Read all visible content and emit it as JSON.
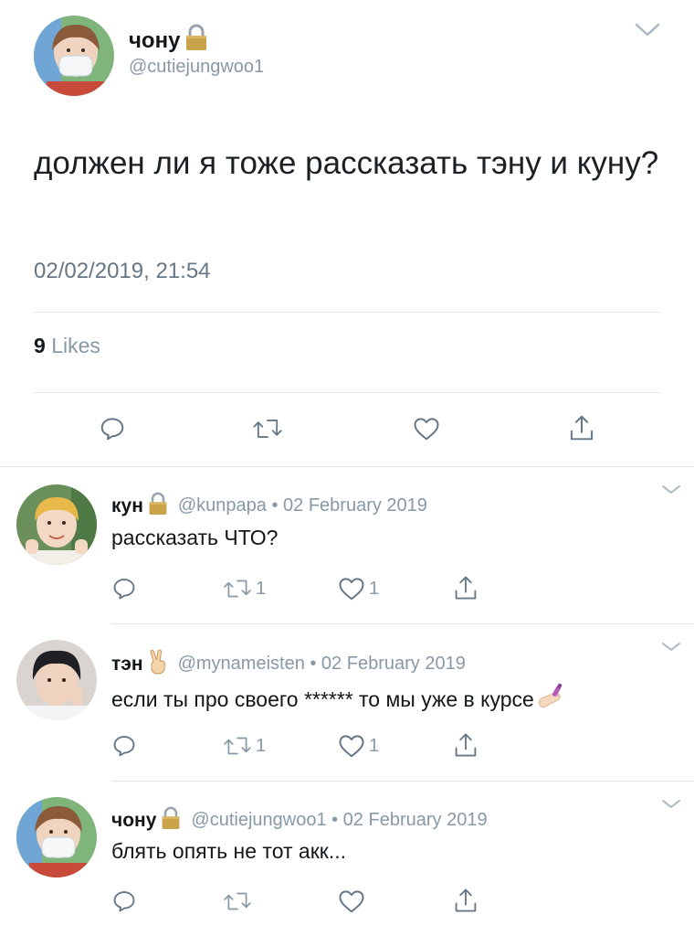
{
  "main_tweet": {
    "name": "чону",
    "handle": "@cutiejungwoo1",
    "text": "должен ли я тоже рассказать тэну и куну?",
    "timestamp": "02/02/2019, 21:54",
    "likes_count": "9",
    "likes_label": "Likes"
  },
  "replies": [
    {
      "name": "кун",
      "meta": "@kunpapa • 02 February 2019",
      "text": "рассказать ЧТО?",
      "retweets": "1",
      "likes": "1"
    },
    {
      "name": "тэн",
      "meta": "@mynameisten • 02 February 2019",
      "text": "если ты про своего ****** то мы уже в курсе",
      "retweets": "1",
      "likes": "1"
    },
    {
      "name": "чону",
      "meta": "@cutiejungwoo1 • 02 February 2019",
      "text": "блять опять не тот акк...",
      "retweets": "",
      "likes": ""
    }
  ],
  "colors": {
    "secondary_text": "#8899a6",
    "divider": "#e1e8ed",
    "lock_body": "#c9a24a"
  },
  "icons": [
    "chevron-down-icon",
    "lock-icon",
    "victory-hand-icon",
    "nail-polish-icon",
    "reply-icon",
    "retweet-icon",
    "heart-icon",
    "share-icon"
  ]
}
